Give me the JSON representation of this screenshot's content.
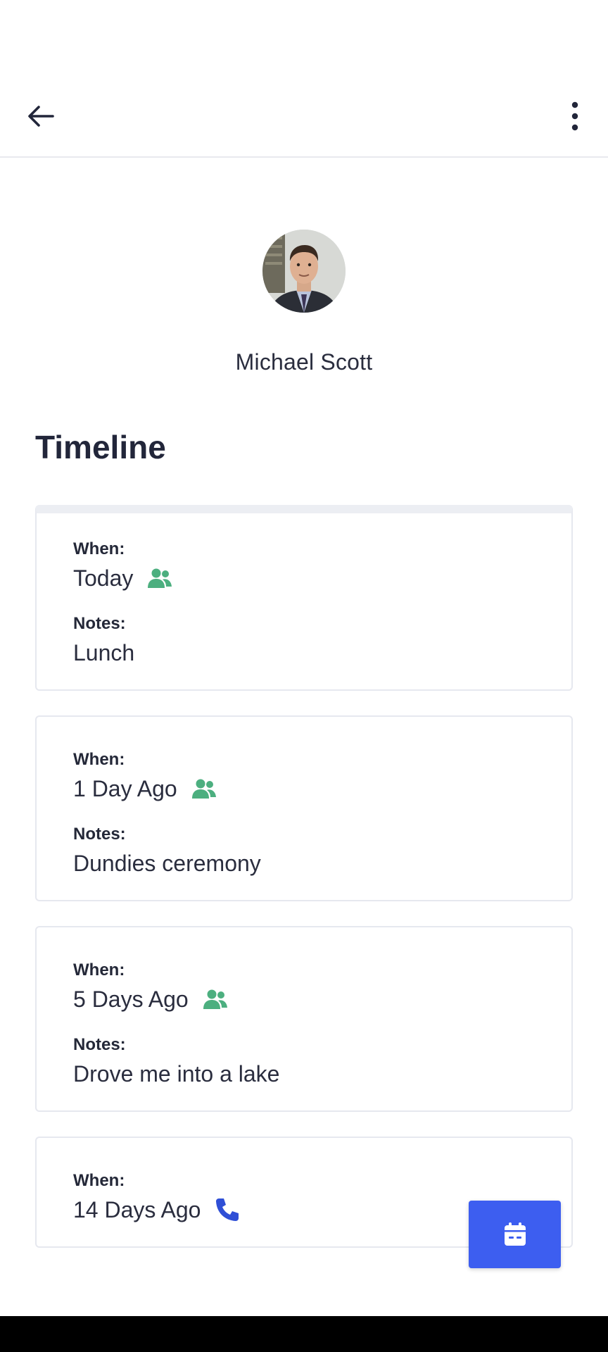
{
  "profile": {
    "name": "Michael Scott"
  },
  "section": {
    "title": "Timeline"
  },
  "timeline": [
    {
      "when_label": "When:",
      "when": "Today",
      "icon": "meeting-people-icon",
      "notes_label": "Notes:",
      "notes": "Lunch"
    },
    {
      "when_label": "When:",
      "when": "1 Day Ago",
      "icon": "meeting-people-icon",
      "notes_label": "Notes:",
      "notes": "Dundies ceremony"
    },
    {
      "when_label": "When:",
      "when": "5 Days Ago",
      "icon": "meeting-people-icon",
      "notes_label": "Notes:",
      "notes": "Drove me into a lake"
    },
    {
      "when_label": "When:",
      "when": "14 Days Ago",
      "icon": "phone-icon"
    }
  ],
  "icons": {
    "back": "arrow-left-icon",
    "more": "more-vertical-icon",
    "fab": "calendar-icon"
  },
  "colors": {
    "people_icon": "#4caf7f",
    "phone_icon": "#2f4fd6",
    "fab": "#3d5ef0",
    "text": "#22263a"
  }
}
